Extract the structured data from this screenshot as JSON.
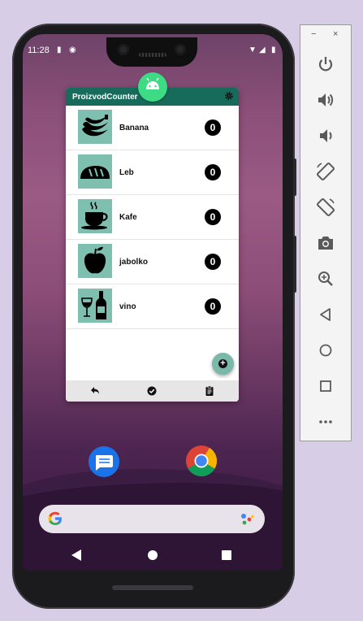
{
  "status_bar": {
    "time": "11:28"
  },
  "app": {
    "title": "ProizvodCounter",
    "products": [
      {
        "name": "Banana",
        "count": "0",
        "icon": "banana-icon"
      },
      {
        "name": "Leb",
        "count": "0",
        "icon": "bread-icon"
      },
      {
        "name": "Kafe",
        "count": "0",
        "icon": "coffee-cup-icon"
      },
      {
        "name": "jabolko",
        "count": "0",
        "icon": "apple-icon"
      },
      {
        "name": "vino",
        "count": "0",
        "icon": "wine-icon"
      }
    ],
    "fab_icon": "add-circle-icon",
    "nav_icons": [
      "back-arrow-icon",
      "check-circle-icon",
      "clipboard-icon"
    ],
    "colors": {
      "header": "#166b5a",
      "thumb": "#7fbfb0",
      "fab": "#7ab9a9"
    }
  },
  "home": {
    "dock_apps": [
      "messages-icon",
      "chrome-icon"
    ],
    "search_icons": [
      "google-logo-icon",
      "assistant-mic-icon"
    ]
  },
  "system_nav": [
    "back-triangle-icon",
    "home-circle-icon",
    "recents-square-icon"
  ],
  "emulator_toolbar": {
    "window_controls": {
      "minimize": "−",
      "close": "×"
    },
    "buttons": [
      "power-icon",
      "volume-up-icon",
      "volume-down-icon",
      "rotate-left-icon",
      "rotate-right-icon",
      "camera-icon",
      "zoom-icon",
      "back-icon",
      "home-icon",
      "overview-icon",
      "more-icon"
    ]
  }
}
